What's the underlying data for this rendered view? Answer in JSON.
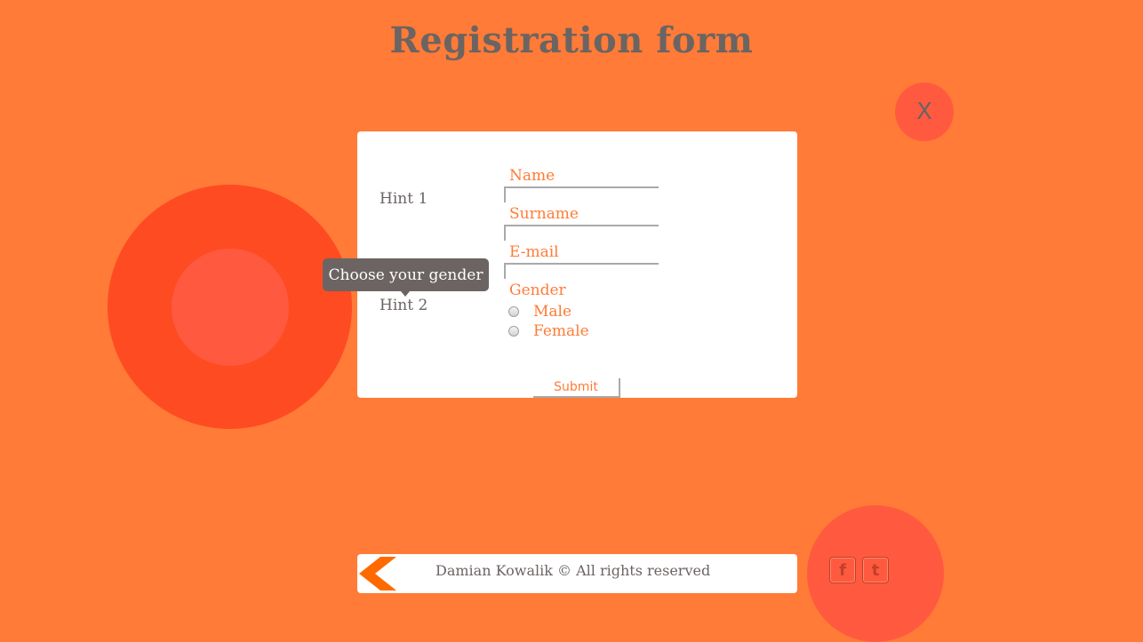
{
  "page": {
    "title": "Registration form",
    "close_label": "X"
  },
  "form": {
    "hint1": "Hint 1",
    "hint2": "Hint 2",
    "tooltip": "Choose your gender",
    "fields": {
      "name_label": "Name",
      "surname_label": "Surname",
      "email_label": "E-mail"
    },
    "gender": {
      "label": "Gender",
      "options": [
        "Male",
        "Female"
      ]
    },
    "submit_label": "Submit"
  },
  "footer": {
    "text": "Damian Kowalik © All rights reserved"
  },
  "social": {
    "facebook_glyph": "f",
    "twitter_glyph": "t"
  },
  "colors": {
    "background": "#ff7b37",
    "accent": "#ff5a3f",
    "accent_dark": "#ff4b22",
    "text_gray": "#6b6462",
    "card": "#ffffff"
  },
  "icons": {
    "back": "back-arrow-icon",
    "facebook": "facebook-icon",
    "twitter": "twitter-icon"
  }
}
